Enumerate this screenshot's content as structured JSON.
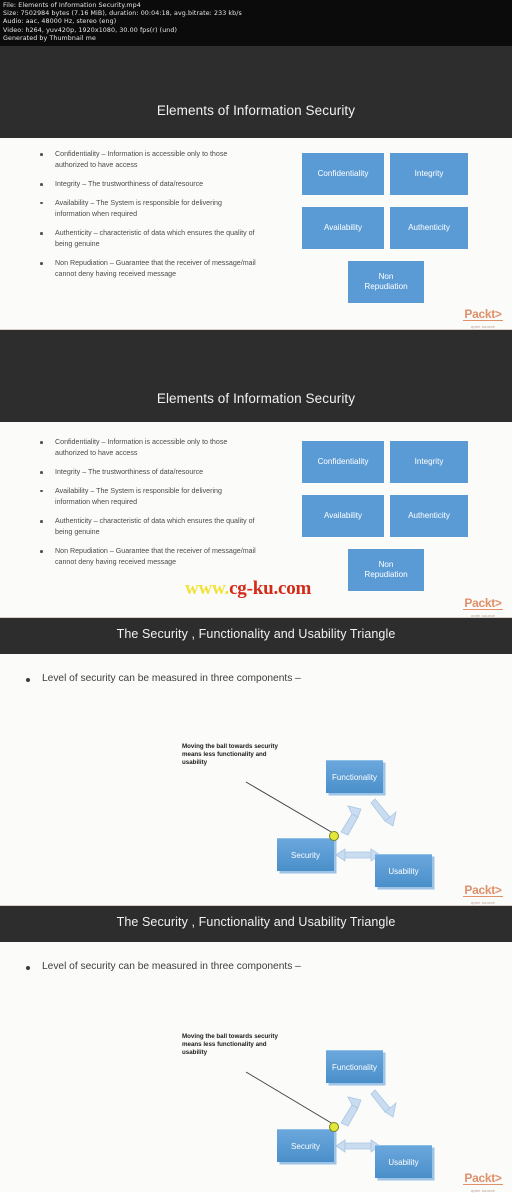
{
  "mediainfo": {
    "line1": "File: Elements of Information Security.mp4",
    "line2": "Size: 7502984 bytes (7.16 MiB), duration: 00:04:18, avg.bitrate: 233 kb/s",
    "line3": "Audio: aac, 48000 Hz, stereo (eng)",
    "line4": "Video: h264, yuv420p, 1920x1080, 30.00 fps(r) (und)",
    "line5": "Generated by Thumbnail me"
  },
  "slides": [
    {
      "title": "Elements of Information Security",
      "bullets": [
        "Confidentiality – Information is accessible only to those authorized to have access",
        "Integrity – The trustworthiness of data/resource",
        "Availability – The System is responsible for delivering information when required",
        "Authenticity – characteristic of data which ensures the quality of being genuine",
        "Non Repudiation – Guarantee that the receiver of message/mail cannot deny having received message"
      ],
      "boxes": [
        "Confidentiality",
        "Integrity",
        "Availability",
        "Authenticity",
        "Non Repudiation"
      ]
    },
    {
      "title": "The Security , Functionality and Usability Triangle",
      "bullet": "Level of security can be measured in three components –",
      "note": "Moving the ball towards security means less functionality and usability",
      "nodes": [
        "Functionality",
        "Security",
        "Usability"
      ]
    }
  ],
  "logo": {
    "word": "Packt>",
    "sub": "open source"
  },
  "watermark": {
    "prefix": "www.",
    "domain": "cg-ku.com"
  },
  "colors": {
    "band": "#2d2d2d",
    "box_blue": "#5b9bd5",
    "ball": "#e2e83a",
    "logo_orange": "#e0906a",
    "watermark_yellow": "#f2e23a",
    "watermark_red": "#d42a18"
  }
}
